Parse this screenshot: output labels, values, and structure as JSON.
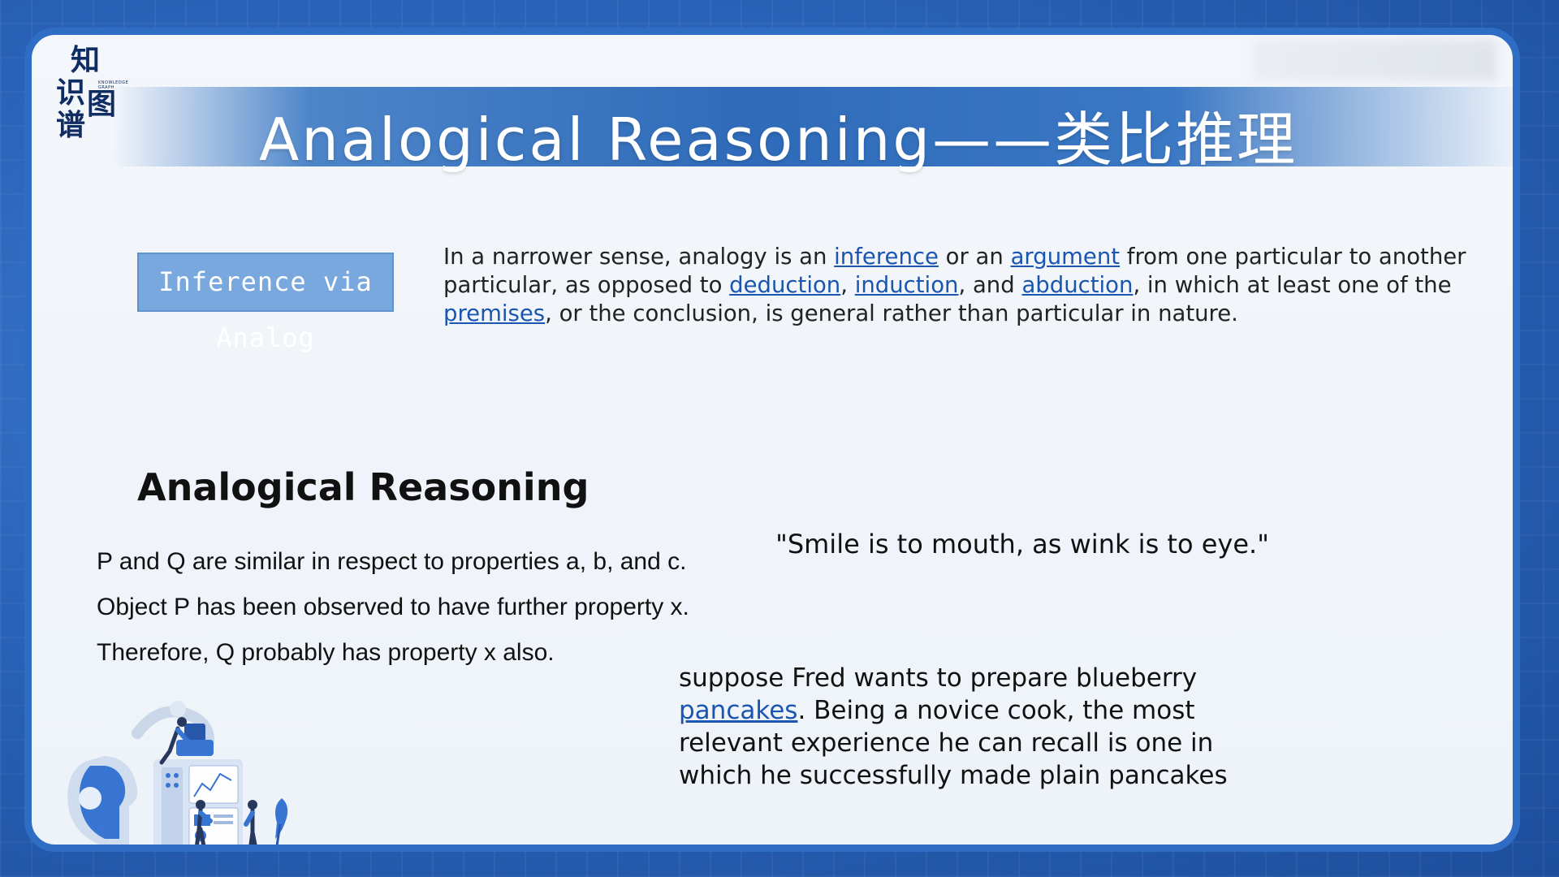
{
  "logo": {
    "chars": [
      "知",
      "识",
      "图",
      "谱"
    ],
    "tiny": "KNOWLEDGE GRAPH"
  },
  "title": "Analogical Reasoning——类比推理",
  "label_box": "Inference via Analog",
  "definition": {
    "t1": "In a narrower sense, analogy is an ",
    "l1": "inference",
    "t2": " or an ",
    "l2": "argument",
    "t3": " from one particular to another particular, as opposed to ",
    "l3": "deduction",
    "t4": ", ",
    "l4": "induction",
    "t5": ", and ",
    "l5": "abduction",
    "t6": ", in which at least one of the ",
    "l6": "premises",
    "t7": ", or the conclusion, is general rather than particular in nature."
  },
  "heading": "Analogical Reasoning",
  "premises": [
    "P and Q are similar in respect to properties a, b, and c.",
    "Object P has been observed to have further property x.",
    "Therefore, Q probably has property x also."
  ],
  "quote": "\"Smile is to mouth, as wink is to eye.\"",
  "story": {
    "t1": "suppose Fred wants to prepare blueberry ",
    "l1": "pancakes",
    "t2": ". Being a novice cook, the most relevant experience he can recall is one in which he successfully made plain pancakes"
  },
  "colors": {
    "frame": "#2f6cc4",
    "label_box": "#78a8dd",
    "link": "#1a56b0",
    "title_band": "#2f6bb9"
  }
}
